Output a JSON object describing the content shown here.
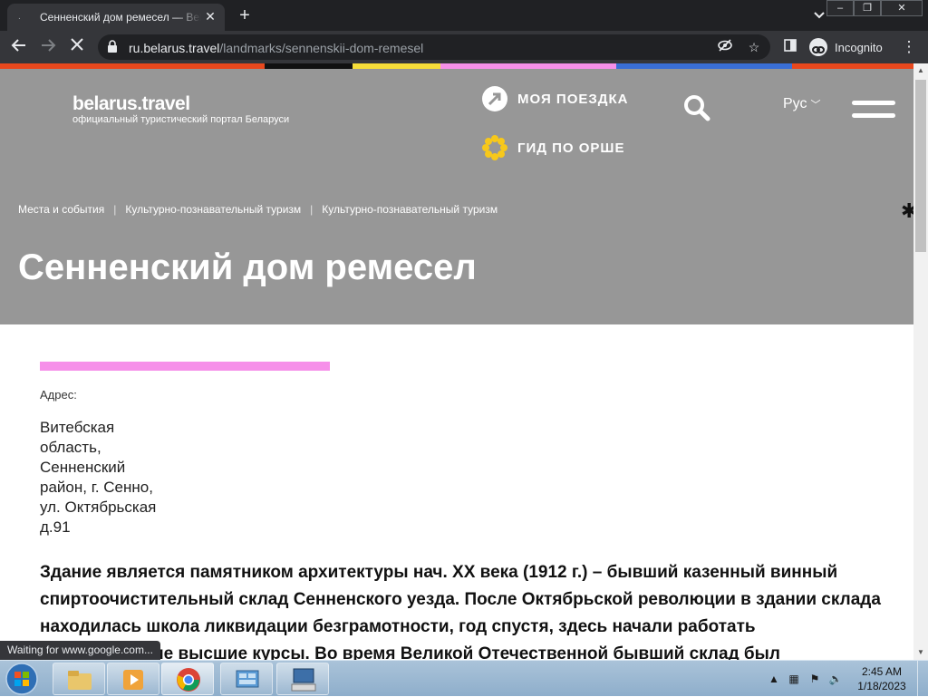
{
  "browser": {
    "tab_title": "Сенненский дом ремесел — Belarus.travel",
    "tab_favicon": ".",
    "close_tab": "✕",
    "new_tab": "+",
    "url_host": "ru.belarus.travel",
    "url_path": "/landmarks/sennenskii-dom-remesel",
    "incognito_label": "Incognito"
  },
  "site": {
    "stripe_colors": [
      "#e8481d",
      "#111111",
      "#f7de3a",
      "#f690e9",
      "#3a6fd6",
      "#e8481d"
    ],
    "logo_main": "belarus.travel",
    "logo_sub": "официальный туристический портал Беларуси",
    "nav_trip": "МОЯ ПОЕЗДКА",
    "nav_guide": "ГИД ПО ОРШЕ",
    "language": "Рус",
    "breadcrumbs": [
      "Места и события",
      "Культурно-познавательный туризм",
      "Культурно-познавательный туризм"
    ],
    "page_title": "Сенненский дом ремесел",
    "address_label": "Адрес:",
    "address_value": "Витебская область, Сенненский район, г. Сенно, ул. Октябрьская д.91",
    "body_text": "Здание является памятником архитектуры нач. XX века (1912 г.) – бывший казенный винный спиртоочистительный склад Сенненского уезда. После Октябрьской революции в здании склада находилась школа ликвидации безграмотности, год спустя, здесь начали работать педагогические высшие курсы. Во время Великой Отечественной бывший склад был"
  },
  "status_text": "Waiting for www.google.com...",
  "taskbar": {
    "time": "2:45 AM",
    "date": "1/18/2023"
  }
}
